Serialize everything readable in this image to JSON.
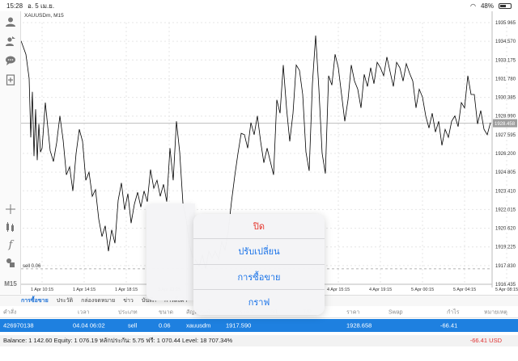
{
  "status_bar": {
    "time": "15:28",
    "date": "อ. 5 เม.ย.",
    "battery": "48%",
    "battery_level": 0.48
  },
  "chart": {
    "symbol": "XAUUSDm, M15",
    "price_levels": [
      "1935.965",
      "1934.570",
      "1933.175",
      "1931.780",
      "1930.385",
      "1928.990",
      "1927.595",
      "1926.200",
      "1924.805",
      "1923.410",
      "1922.015",
      "1920.620",
      "1919.225",
      "1917.830",
      "1916.435"
    ],
    "current_price": "1928.458",
    "time_labels": [
      "1 Apr 10:15",
      "1 Apr 14:15",
      "1 Apr 18:15",
      "3 Apr 23:15",
      "4 Apr 15:15",
      "4 Apr 19:15",
      "5 Apr 00:15",
      "5 Apr 04:15",
      "5 Apr 08:15"
    ],
    "sell_label": "sell 0.06",
    "line_color": "#000000",
    "grid_color": "#e6e6e6"
  },
  "left_toolbar": {
    "icons": [
      "person-icon",
      "person-add-icon",
      "chat-icon",
      "add-document-icon",
      "crosshair-icon",
      "indicators-icon",
      "function-icon",
      "objects-icon"
    ],
    "timeframe": "M15",
    "add": "+"
  },
  "tabs": [
    "การซื้อขาย",
    "ประวัติ",
    "กล่องจดหมาย",
    "ข่าว",
    "บันทึก",
    "การตั้งค่า"
  ],
  "table": {
    "headers": [
      "คำสั่ง",
      "เวลา",
      "ประเภท",
      "ขนาด",
      "สัญลักษณ์",
      "ราคา",
      "S/L",
      "T/P",
      "ราคา",
      "Swap",
      "กำไร",
      "หมายเหตุ"
    ],
    "row": {
      "order": "426970138",
      "time": "04.04 06:02",
      "type": "sell",
      "volume": "0.06",
      "symbol": "xauusdm",
      "open_price": "1917.590",
      "price": "1928.658",
      "profit": "-66.41"
    }
  },
  "balance_bar": {
    "text": "Balance: 1 142.60 Equity: 1 076.19 หลักประกัน: 5.75 ฟรี: 1 070.44 Level: 18 707.34%",
    "profit": "-66.41",
    "currency": "USD"
  },
  "action_menu": {
    "items": [
      "ปิด",
      "ปรับเปลี่ยน",
      "การซื้อขาย",
      "กราฟ"
    ],
    "destructive_color": "#e5352b",
    "item_color": "#1a73e8"
  }
}
